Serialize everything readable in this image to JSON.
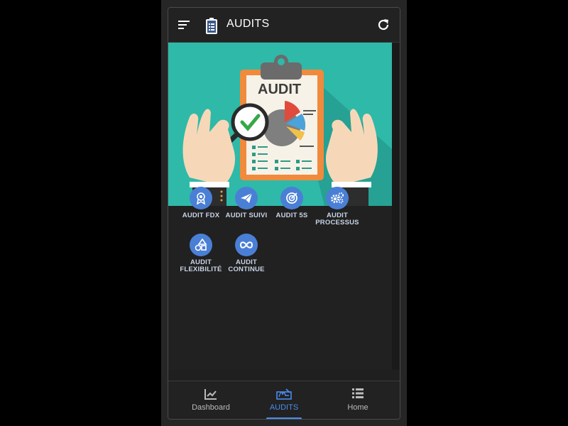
{
  "header": {
    "title": "AUDITS"
  },
  "hero": {
    "board_text": "AUDIT"
  },
  "tiles": [
    {
      "label_line1": "AUDIT FDX",
      "label_line2": "",
      "icon": "award-icon"
    },
    {
      "label_line1": "AUDIT SUIVI",
      "label_line2": "",
      "icon": "paper-plane-icon"
    },
    {
      "label_line1": "AUDIT 5S",
      "label_line2": "",
      "icon": "target-icon"
    },
    {
      "label_line1": "AUDIT",
      "label_line2": "PROCESSUS",
      "icon": "gears-icon"
    },
    {
      "label_line1": "AUDIT",
      "label_line2": "FLEXIBILITÉ",
      "icon": "shapes-icon"
    },
    {
      "label_line1": "AUDIT",
      "label_line2": "CONTINUE",
      "icon": "infinity-icon"
    }
  ],
  "bottom_nav": [
    {
      "label": "Dashboard",
      "icon": "chart-line-icon"
    },
    {
      "label": "AUDITS",
      "icon": "signature-icon",
      "active": true
    },
    {
      "label": "Home",
      "icon": "list-icon"
    }
  ],
  "colors": {
    "accent": "#4a8cf0",
    "tile": "#4a7fd6",
    "hero_bg": "#2fb9a8"
  }
}
